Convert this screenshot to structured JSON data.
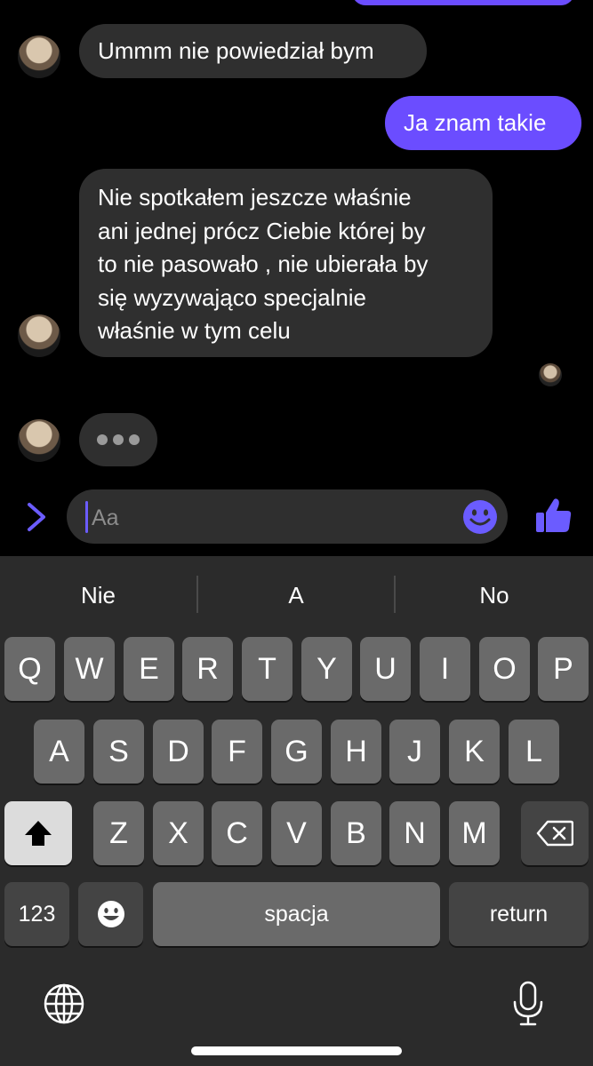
{
  "conversation": {
    "messages": [
      {
        "sender": "other",
        "text": "Ummm nie powiedział bym"
      },
      {
        "sender": "me",
        "text": "Ja znam takie"
      },
      {
        "sender": "other",
        "lines": [
          "Nie spotkałem jeszcze właśnie",
          "ani jednej prócz Ciebie której by",
          "to nie pasowało , nie ubierała by",
          "się wyzywająco specjalnie",
          "właśnie w tym celu"
        ]
      }
    ],
    "typing_indicator": "typing"
  },
  "composer": {
    "placeholder": "Aa"
  },
  "keyboard": {
    "suggestions": [
      "Nie",
      "A",
      "No"
    ],
    "row1": [
      "Q",
      "W",
      "E",
      "R",
      "T",
      "Y",
      "U",
      "I",
      "O",
      "P"
    ],
    "row2": [
      "A",
      "S",
      "D",
      "F",
      "G",
      "H",
      "J",
      "K",
      "L"
    ],
    "row3": [
      "Z",
      "X",
      "C",
      "V",
      "B",
      "N",
      "M"
    ],
    "numbers_label": "123",
    "space_label": "spacja",
    "return_label": "return"
  },
  "colors": {
    "accent": "#6b4dff",
    "bubble_other": "#2f2f2f",
    "background": "#000000",
    "keyboard_bg": "#2b2b2b"
  },
  "icons": [
    "chevron-right-icon",
    "emoji-icon",
    "thumbs-up-icon",
    "shift-icon",
    "backspace-icon",
    "emoji-keyboard-icon",
    "globe-icon",
    "microphone-icon"
  ]
}
